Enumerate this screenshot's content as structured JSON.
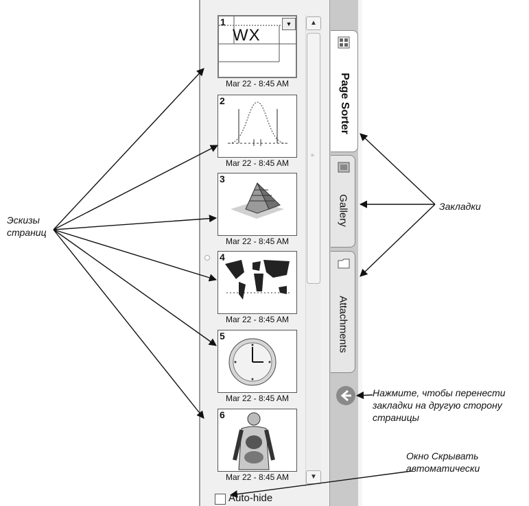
{
  "annotations": {
    "thumbnails": [
      "Эскизы",
      "страниц"
    ],
    "tabs": "Закладки",
    "swap": [
      "Нажмите, чтобы перенести",
      "закладки на другую сторону",
      "страницы"
    ],
    "autohide": [
      "Окно Скрывать",
      "автоматически"
    ]
  },
  "pages": [
    {
      "number": "1",
      "caption": "Mar 22 - 8:45 AM",
      "preview": "WX",
      "icon": "table-icon"
    },
    {
      "number": "2",
      "caption": "Mar 22 - 8:45 AM",
      "icon": "bell-curve-chart-icon"
    },
    {
      "number": "3",
      "caption": "Mar 22 - 8:45 AM",
      "icon": "pyramid-icon"
    },
    {
      "number": "4",
      "caption": "Mar 22 - 8:45 AM",
      "icon": "world-map-icon"
    },
    {
      "number": "5",
      "caption": "Mar 22 - 8:45 AM",
      "icon": "clock-icon"
    },
    {
      "number": "6",
      "caption": "Mar 22 - 8:45 AM",
      "icon": "human-anatomy-icon"
    }
  ],
  "tabs": [
    {
      "label": "Page Sorter",
      "icon": "page-sorter-icon",
      "active": true
    },
    {
      "label": "Gallery",
      "icon": "gallery-icon",
      "active": false
    },
    {
      "label": "Attachments",
      "icon": "folder-icon",
      "active": false
    }
  ],
  "autohide_label": "Auto-hide",
  "autohide_checked": false
}
